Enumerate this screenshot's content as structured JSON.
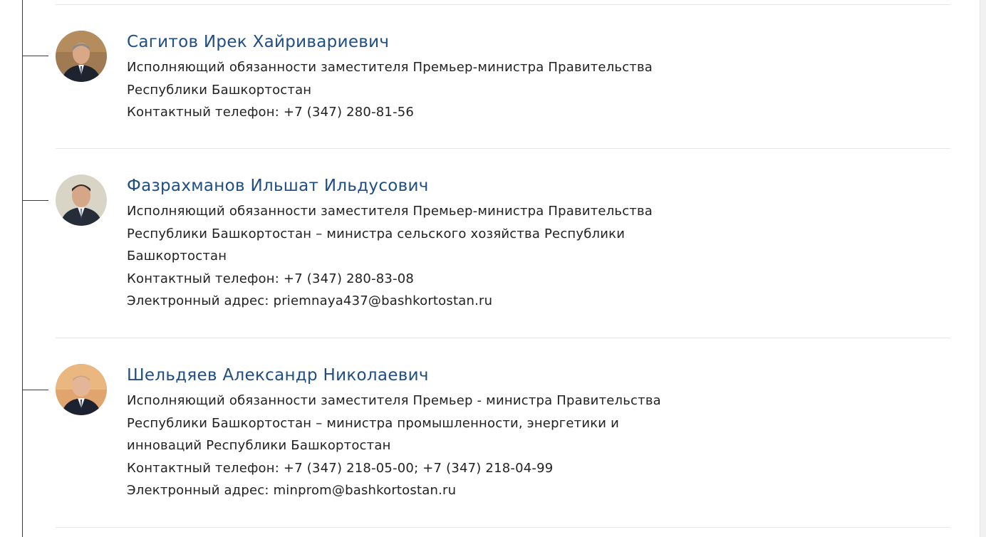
{
  "officials": [
    {
      "name": "Сагитов Ирек Хайривариевич",
      "position_lines": [
        "Исполняющий обязанности заместителя Премьер-министра Правительства",
        "Республики Башкортостан"
      ],
      "phone": "Контактный телефон: +7 (347) 280-81-56"
    },
    {
      "name": "Фазрахманов Ильшат Ильдусович",
      "position_lines": [
        "Исполняющий обязанности заместителя Премьер-министра Правительства",
        "Республики Башкортостан – министра сельского хозяйства Республики",
        "Башкортостан"
      ],
      "phone": "Контактный телефон: +7 (347) 280-83-08",
      "email": "Электронный адрес: priemnaya437@bashkortostan.ru"
    },
    {
      "name": "Шельдяев Александр Николаевич",
      "position_lines": [
        "Исполняющий обязанности заместителя Премьер - министра Правительства",
        "Республики Башкортостан – министра промышленности, энергетики и",
        "инноваций Республики Башкортостан"
      ],
      "phone": "Контактный телефон: +7 (347) 218-05-00; +7 (347) 218-04-99",
      "email": "Электронный адрес: minprom@bashkortostan.ru"
    }
  ]
}
